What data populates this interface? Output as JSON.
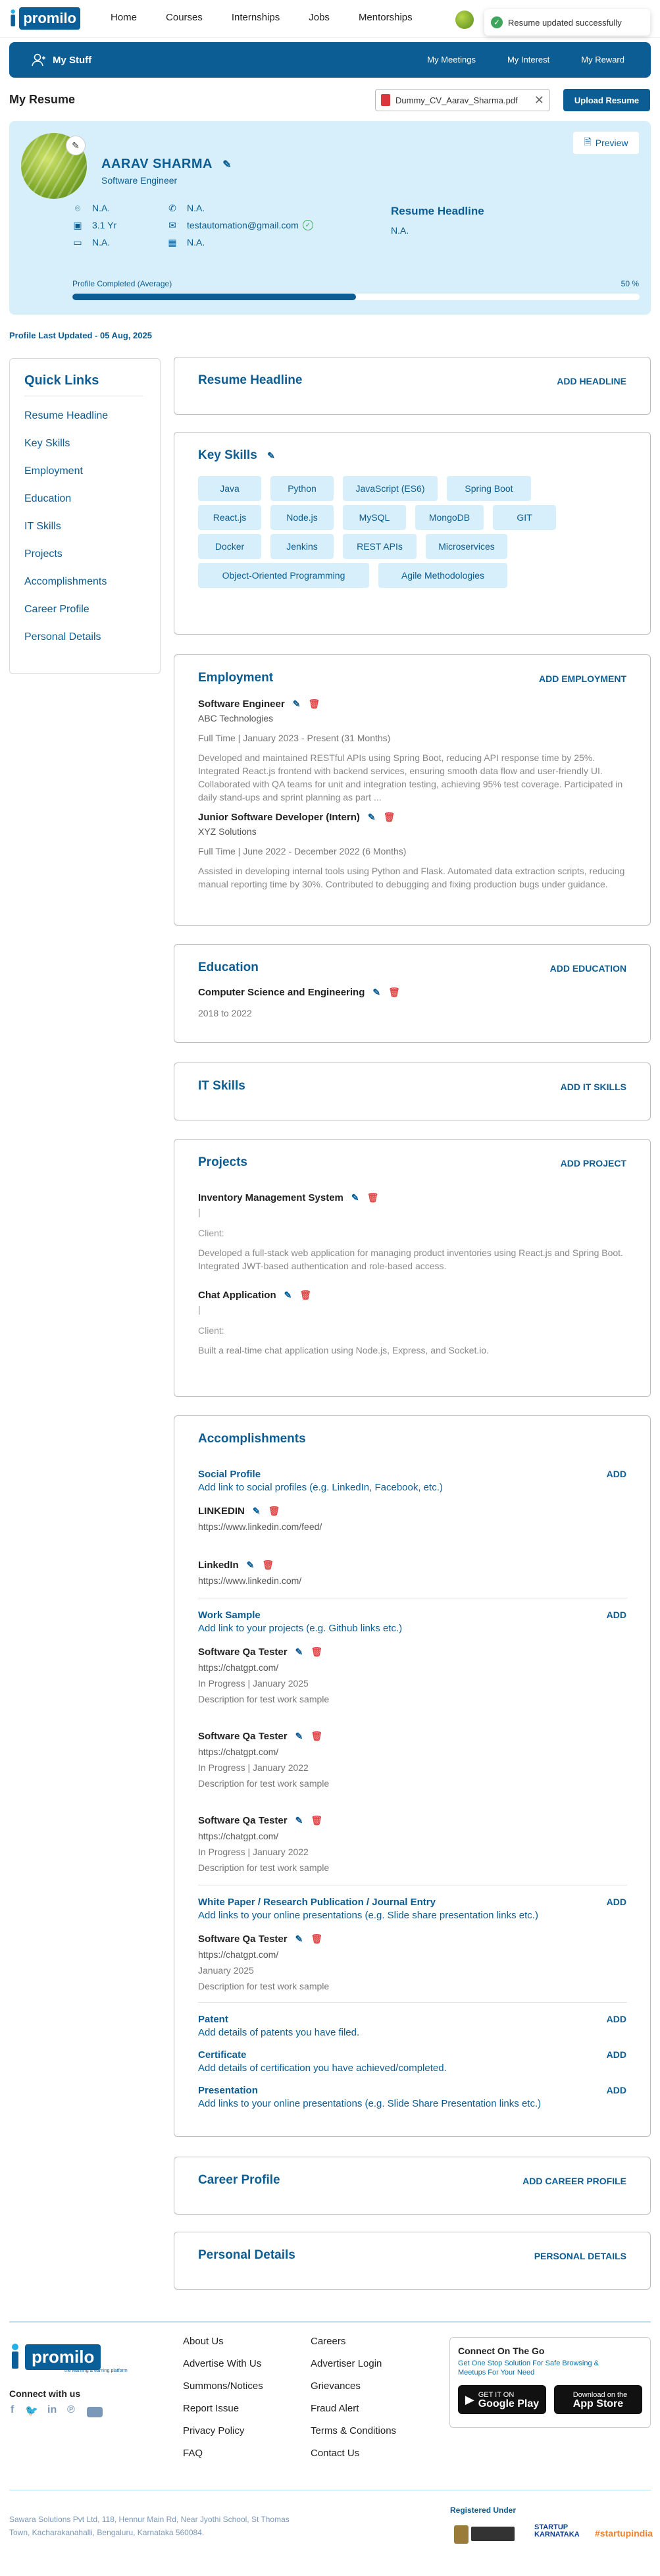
{
  "nav": {
    "items": [
      "Home",
      "Courses",
      "Internships",
      "Jobs",
      "Mentorships"
    ],
    "logo_text": "promilo",
    "toast": "Resume updated successfully"
  },
  "stuffbar": {
    "title": "My Stuff",
    "links": [
      "My Meetings",
      "My Interest",
      "My Reward"
    ]
  },
  "resume": {
    "heading": "My Resume",
    "file_name": "Dummy_CV_Aarav_Sharma.pdf",
    "upload_label": "Upload Resume"
  },
  "profile": {
    "name": "AARAV SHARMA",
    "role": "Software Engineer",
    "preview_label": "Preview",
    "location": "N.A.",
    "experience": "3.1 Yr",
    "salary": "N.A.",
    "phone": "N.A.",
    "email": "testautomation@gmail.com",
    "notice": "N.A.",
    "headline_title": "Resume Headline",
    "headline_value": "N.A.",
    "completion_label": "Profile Completed (Average)",
    "completion_pct_text": "50 %",
    "completion_fraction": 0.5
  },
  "last_updated": "Profile Last Updated - 05 Aug, 2025",
  "quick_links": {
    "title": "Quick Links",
    "items": [
      "Resume Headline",
      "Key Skills",
      "Employment",
      "Education",
      "IT Skills",
      "Projects",
      "Accomplishments",
      "Career Profile",
      "Personal Details"
    ]
  },
  "headline_card": {
    "title": "Resume Headline",
    "add": "ADD HEADLINE"
  },
  "skills_card": {
    "title": "Key Skills",
    "skills": [
      "Java",
      "Python",
      "JavaScript (ES6)",
      "Spring Boot",
      "React.js",
      "Node.js",
      "MySQL",
      "MongoDB",
      "GIT",
      "Docker",
      "Jenkins",
      "REST APIs",
      "Microservices",
      "Object-Oriented Programming",
      "Agile Methodologies"
    ]
  },
  "employment_card": {
    "title": "Employment",
    "add": "ADD EMPLOYMENT",
    "jobs": [
      {
        "title": "Software Engineer",
        "company": "ABC Technologies",
        "meta": "Full Time  |  January 2023 - Present (31 Months)",
        "desc": "Developed and maintained RESTful APIs using Spring Boot, reducing API response time by 25%. Integrated React.js frontend with backend services, ensuring smooth data flow and user-friendly UI. Collaborated with QA teams for unit and integration testing, achieving 95% test coverage. Participated in daily stand-ups and sprint planning as part ..."
      },
      {
        "title": "Junior Software Developer (Intern)",
        "company": "XYZ Solutions",
        "meta": "Full Time  |  June 2022 - December 2022 (6 Months)",
        "desc": "Assisted in developing internal tools using Python and Flask. Automated data extraction scripts, reducing manual reporting time by 30%. Contributed to debugging and fixing production bugs under guidance."
      }
    ]
  },
  "education_card": {
    "title": "Education",
    "add": "ADD EDUCATION",
    "degree": "Computer Science and Engineering",
    "years": "2018 to 2022"
  },
  "itskills_card": {
    "title": "IT Skills",
    "add": "ADD IT SKILLS"
  },
  "projects_card": {
    "title": "Projects",
    "add": "ADD PROJECT",
    "projects": [
      {
        "title": "Inventory Management System",
        "sep": "|",
        "client": "Client:",
        "desc": "Developed a full-stack web application for managing product inventories using React.js and Spring Boot. Integrated JWT-based authentication and role-based access."
      },
      {
        "title": "Chat Application",
        "sep": "|",
        "client": "Client:",
        "desc": "Built a real-time chat application using Node.js, Express, and Socket.io."
      }
    ]
  },
  "accomplishments_card": {
    "title": "Accomplishments",
    "add": "ADD",
    "social": {
      "heading": "Social Profile",
      "sub": "Add link to social profiles (e.g. LinkedIn, Facebook, etc.)",
      "items": [
        {
          "name": "LINKEDIN",
          "url": "https://www.linkedin.com/feed/"
        },
        {
          "name": "LinkedIn",
          "url": "https://www.linkedin.com/"
        }
      ]
    },
    "work": {
      "heading": "Work Sample",
      "sub": "Add link to your projects (e.g. Github links etc.)",
      "items": [
        {
          "name": "Software Qa Tester",
          "url": "https://chatgpt.com/",
          "status": "In Progress | January 2025",
          "desc": "Description for test work sample"
        },
        {
          "name": "Software Qa Tester",
          "url": "https://chatgpt.com/",
          "status": "In Progress | January 2022",
          "desc": "Description for test work sample"
        },
        {
          "name": "Software Qa Tester",
          "url": "https://chatgpt.com/",
          "status": "In Progress | January 2022",
          "desc": "Description for test work sample"
        }
      ]
    },
    "paper": {
      "heading": "White Paper / Research Publication / Journal Entry",
      "sub": "Add links to your online presentations (e.g. Slide share presentation links etc.)",
      "item": {
        "name": "Software Qa Tester",
        "url": "https://chatgpt.com/",
        "date": "January 2025",
        "desc": "Description for test work sample"
      }
    },
    "patent": {
      "heading": "Patent",
      "sub": "Add details of patents you have filed."
    },
    "certificate": {
      "heading": "Certificate",
      "sub": "Add details of certification you have achieved/completed."
    },
    "presentation": {
      "heading": "Presentation",
      "sub": "Add links to your online presentations (e.g. Slide Share Presentation links etc.)"
    }
  },
  "career_card": {
    "title": "Career Profile",
    "add": "ADD CAREER PROFILE"
  },
  "personal_card": {
    "title": "Personal Details",
    "add": "PERSONAL DETAILS"
  },
  "footer": {
    "tagline": "the learning & earning platform",
    "connect_with_us": "Connect with us",
    "col1": [
      "About Us",
      "Advertise With Us",
      "Summons/Notices",
      "Report Issue",
      "Privacy Policy",
      "FAQ"
    ],
    "col2": [
      "Careers",
      "Advertiser Login",
      "Grievances",
      "Fraud Alert",
      "Terms & Conditions",
      "Contact Us"
    ],
    "connect_title": "Connect On The Go",
    "connect_sub": "Get One Stop Solution For Safe Browsing & Meetups For Your Need",
    "google_small": "GET IT ON",
    "google_big": "Google Play",
    "apple_small": "Download on the",
    "apple_big": "App Store",
    "address_line1": "Sawara Solutions Pvt Ltd, 118, Hennur Main Rd, Near Jyothi School, St Thomas",
    "address_line2": "Town, Kacharakanahalli, Bengaluru, Karnataka 560084.",
    "registered": "Registered Under",
    "badge_startup_ka": "STARTUP KARNATAKA",
    "badge_startupindia": "#startupindia"
  }
}
